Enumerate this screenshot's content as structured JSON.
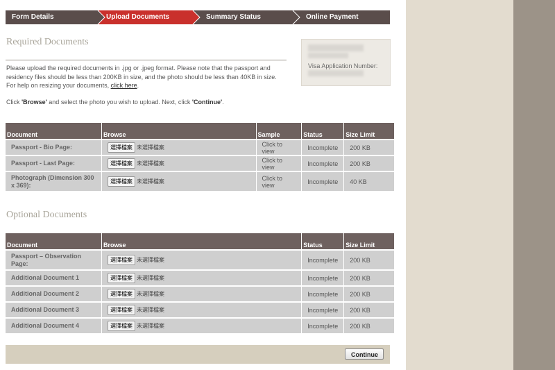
{
  "steps": [
    {
      "label": "Form Details",
      "active": false
    },
    {
      "label": "Upload Documents",
      "active": true
    },
    {
      "label": "Summary Status",
      "active": false
    },
    {
      "label": "Online Payment",
      "active": false
    }
  ],
  "colors": {
    "step_bar": "#5a4d4b",
    "step_active": "#c9302c",
    "table_header": "#6e615f",
    "row_bg": "#cfcfcf"
  },
  "required": {
    "title": "Required Documents",
    "intro_1": "Please upload the required documents in .jpg or .jpeg format. Please note that the passport and residency files should be less than 200KB in size, and the photo should be less than 40KB in size. For help on resizing your documents, ",
    "help_link": "click here",
    "intro_end": ".",
    "click_1": "Click ",
    "browse_word": "'Browse'",
    "click_2": " and select the photo you wish to upload. Next, click ",
    "continue_word": "'Continue'",
    "click_3": ".",
    "headers": {
      "document": "Document",
      "browse": "Browse",
      "sample": "Sample",
      "status": "Status",
      "size": "Size Limit"
    },
    "rows": [
      {
        "name": "Passport - Bio Page:",
        "sample": "Click to view",
        "status": "Incomplete",
        "size": "200 KB"
      },
      {
        "name": "Passport - Last Page:",
        "sample": "Click to view",
        "status": "Incomplete",
        "size": "200 KB"
      },
      {
        "name": "Photograph (Dimension 300 x 369):",
        "sample": "Click to view",
        "status": "Incomplete",
        "size": "40 KB"
      }
    ]
  },
  "optional": {
    "title": "Optional Documents",
    "headers": {
      "document": "Document",
      "browse": "Browse",
      "status": "Status",
      "size": "Size Limit"
    },
    "rows": [
      {
        "name": "Passport – Observation Page:",
        "status": "Incomplete",
        "size": "200 KB"
      },
      {
        "name": "Additional Document 1",
        "status": "Incomplete",
        "size": "200 KB"
      },
      {
        "name": "Additional Document 2",
        "status": "Incomplete",
        "size": "200 KB"
      },
      {
        "name": "Additional Document 3",
        "status": "Incomplete",
        "size": "200 KB"
      },
      {
        "name": "Additional Document 4",
        "status": "Incomplete",
        "size": "200 KB"
      }
    ]
  },
  "file_input": {
    "button": "選擇檔案",
    "no_file": "未選擇檔案"
  },
  "visa_box": {
    "label": "Visa Application Number:"
  },
  "continue_button": "Continue"
}
